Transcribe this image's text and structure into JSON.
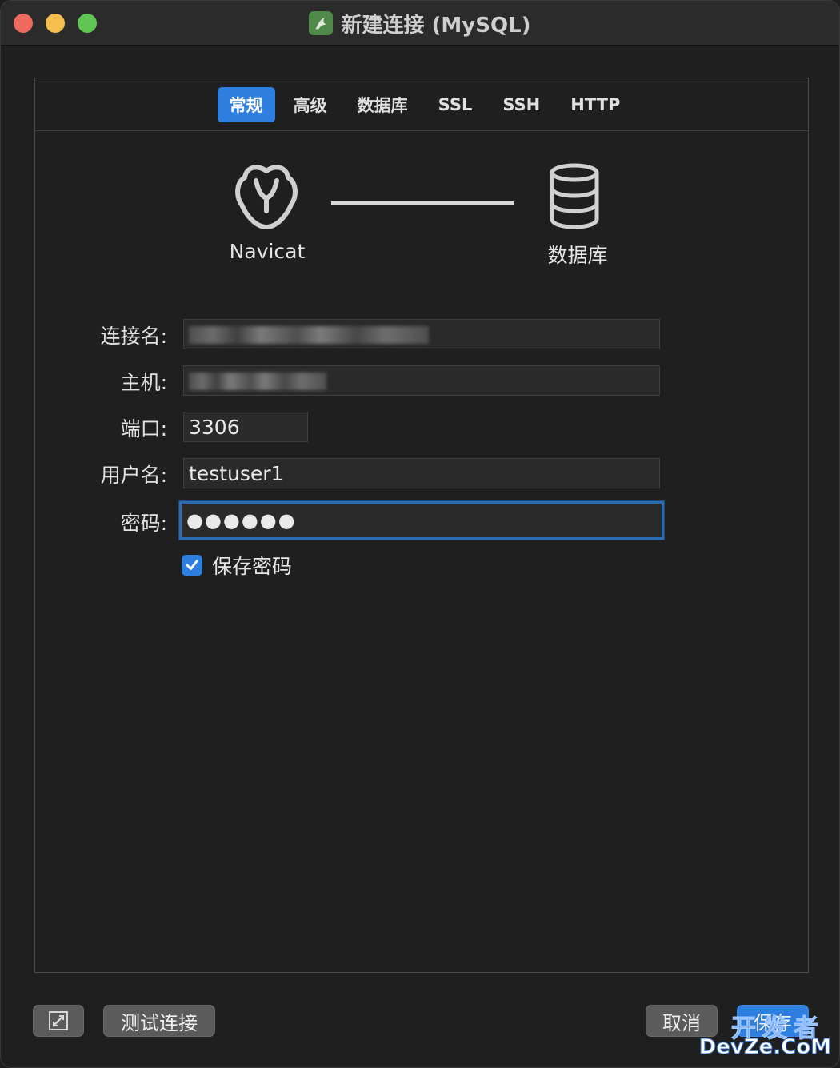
{
  "window": {
    "title": "新建连接 (MySQL)"
  },
  "tabs": [
    {
      "label": "常规",
      "active": true
    },
    {
      "label": "高级",
      "active": false
    },
    {
      "label": "数据库",
      "active": false
    },
    {
      "label": "SSL",
      "active": false
    },
    {
      "label": "SSH",
      "active": false
    },
    {
      "label": "HTTP",
      "active": false
    }
  ],
  "diagram": {
    "left_label": "Navicat",
    "right_label": "数据库",
    "left_icon": "navicat-logo-icon",
    "right_icon": "database-icon"
  },
  "form": {
    "connection_name": {
      "label": "连接名:",
      "value": ""
    },
    "host": {
      "label": "主机:",
      "value": ""
    },
    "port": {
      "label": "端口:",
      "value": "3306"
    },
    "username": {
      "label": "用户名:",
      "value": "testuser1"
    },
    "password": {
      "label": "密码:",
      "value": "●●●●●●"
    },
    "save_password": {
      "label": "保存密码",
      "checked": true
    }
  },
  "buttons": {
    "test_connection": "测试连接",
    "cancel": "取消",
    "save": "保存",
    "icon_button": "edit-connection-icon"
  },
  "watermark": {
    "top": "开发者",
    "bottom": "DevZe.CoM"
  },
  "colors": {
    "accent": "#2f7fe0",
    "background": "#1f1f1f",
    "field_bg": "#2a2a2a"
  }
}
